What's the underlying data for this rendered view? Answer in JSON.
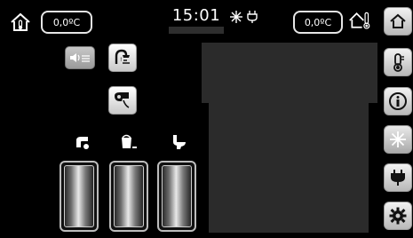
{
  "header": {
    "indoor_temperature": "0,0ºC",
    "time": "15:01",
    "status_icons": [
      "snowflake-icon",
      "plug-icon"
    ],
    "outdoor_temperature": "0,0ºC"
  },
  "controls": {
    "row1": [
      "sound-disabled-icon",
      "shower-warning-icon"
    ],
    "row2": [
      "hair-dryer-icon"
    ],
    "outlets": [
      {
        "icon": "tap-icon"
      },
      {
        "icon": "bucket-icon"
      },
      {
        "icon": "toilet-icon"
      }
    ]
  },
  "sidebar": {
    "items": [
      "home-icon",
      "thermometer-icon",
      "info-icon",
      "snowflake-icon",
      "plug-icon",
      "gear-icon"
    ]
  }
}
